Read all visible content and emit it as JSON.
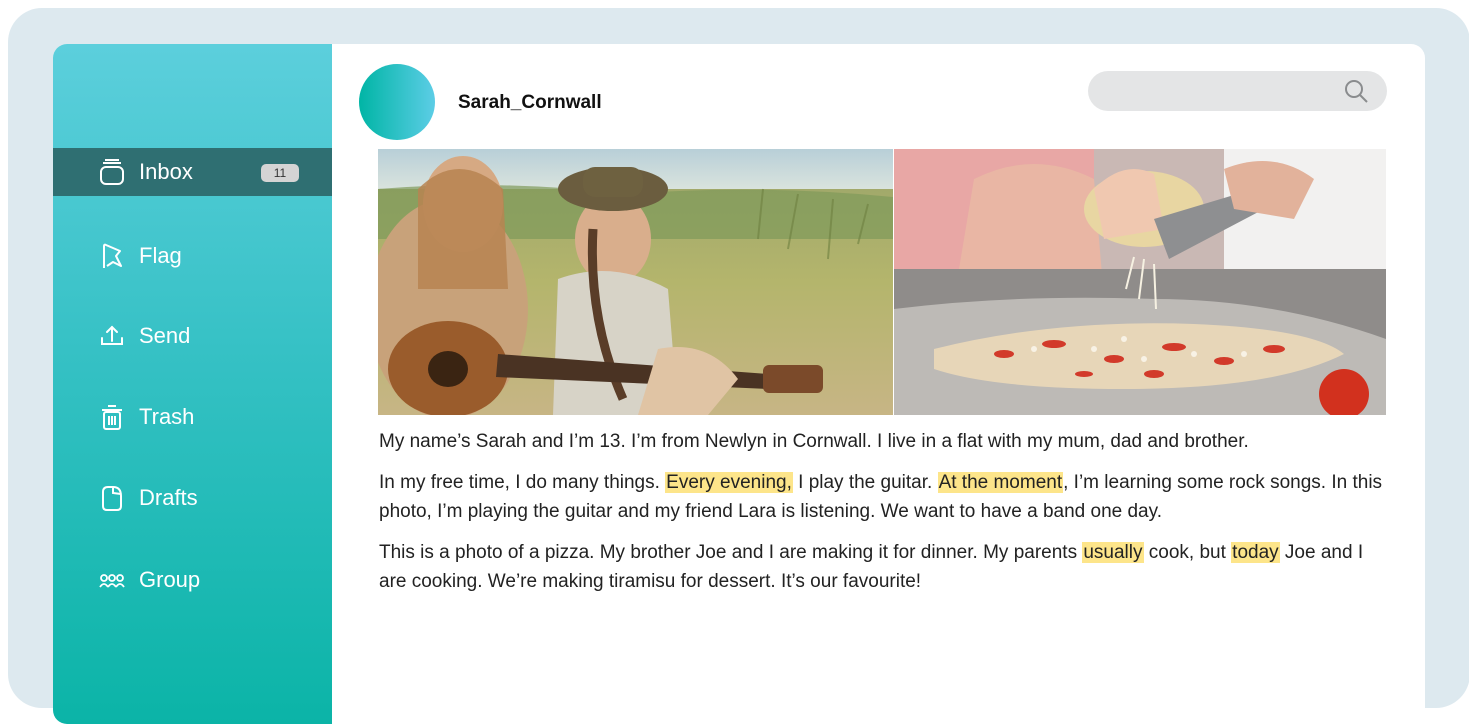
{
  "sidebar": {
    "items": [
      {
        "label": "Inbox",
        "icon": "inbox-icon",
        "badge": "11",
        "active": true
      },
      {
        "label": "Flag",
        "icon": "flag-icon"
      },
      {
        "label": "Send",
        "icon": "send-icon"
      },
      {
        "label": "Trash",
        "icon": "trash-icon"
      },
      {
        "label": "Drafts",
        "icon": "drafts-icon"
      },
      {
        "label": "Group",
        "icon": "group-icon"
      }
    ]
  },
  "post": {
    "username": "Sarah_Cornwall",
    "photos": [
      {
        "subject": "two girls sitting in a field, one playing an acoustic guitar"
      },
      {
        "subject": "hands grating cheese over a homemade pizza"
      }
    ],
    "paragraphs": [
      [
        "My name’s Sarah and I’m 13. I’m from Newlyn in Cornwall. I live in a flat with my mum, dad and brother."
      ],
      [
        "In my free time, I do many things. ",
        "Every evening,",
        " I play the guitar. ",
        "At the moment",
        ", I’m learning some rock songs. In this photo, I’m playing the guitar and my friend Lara is listening. We want to have a band one day."
      ],
      [
        "This is a photo of a pizza. My brother Joe and I are making it for dinner. My parents ",
        "usually",
        " cook, but ",
        "today",
        " Joe and I are cooking. We’re making tiramisu for dessert. It’s our favourite!"
      ]
    ]
  },
  "colors": {
    "sidebar_top": "#5ccfdc",
    "sidebar_bottom": "#0bb4a7",
    "active_item": "#2f6f72",
    "highlight": "#fde58a"
  }
}
